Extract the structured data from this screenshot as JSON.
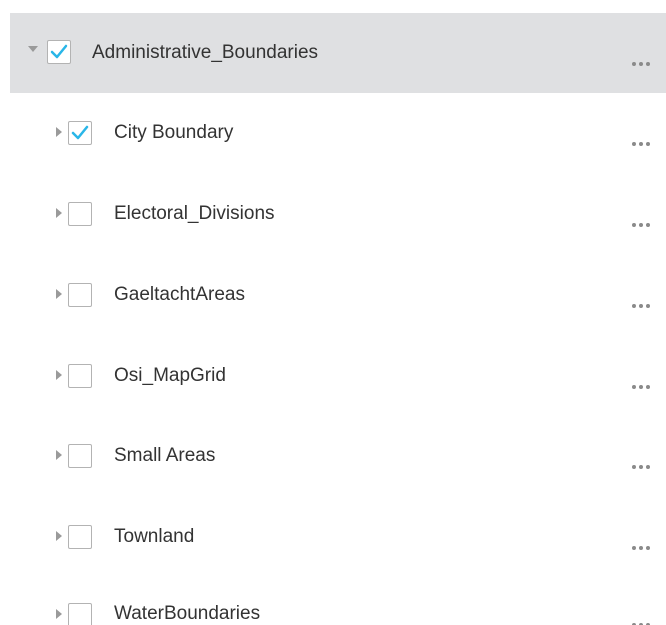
{
  "layer_list": {
    "group": {
      "label": "Administrative_Boundaries",
      "checked": true,
      "expanded": true
    },
    "layers": [
      {
        "label": "City Boundary",
        "checked": true
      },
      {
        "label": "Electoral_Divisions",
        "checked": false
      },
      {
        "label": "GaeltachtAreas",
        "checked": false
      },
      {
        "label": "Osi_MapGrid",
        "checked": false
      },
      {
        "label": "Small Areas",
        "checked": false
      },
      {
        "label": "Townland",
        "checked": false
      },
      {
        "label": "WaterBoundaries",
        "checked": false
      }
    ],
    "more_icon": "more-horizontal-icon",
    "check_color": "#29b6e8",
    "group_background": "#dfe0e2"
  }
}
